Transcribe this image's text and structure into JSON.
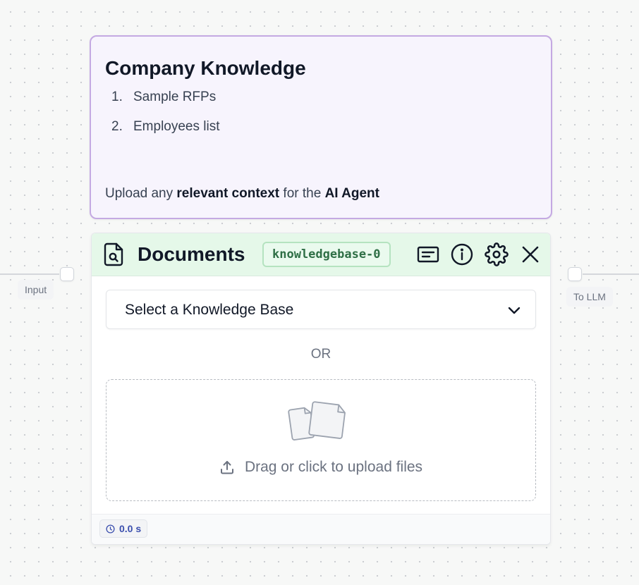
{
  "canvas": {
    "edges": [
      "input-edge",
      "output-edge"
    ]
  },
  "handles": {
    "input_label": "Input",
    "output_label": "To LLM"
  },
  "note": {
    "title": "Company Knowledge",
    "list": [
      {
        "number": "1.",
        "text": "Sample RFPs"
      },
      {
        "number": "2.",
        "text": "Employees list"
      }
    ],
    "footer_prefix": "Upload any ",
    "footer_bold_1": "relevant context",
    "footer_middle": " for the ",
    "footer_bold_2": "AI Agent",
    "colors": {
      "background": "#f7f4fd",
      "border": "#c4a9e2"
    }
  },
  "documents_node": {
    "title": "Documents",
    "badge": "knowledgebase-0",
    "header_icons": [
      "file-search-icon",
      "description-icon",
      "info-icon",
      "gear-icon",
      "close-icon"
    ],
    "select": {
      "placeholder": "Select a Knowledge Base",
      "icon": "chevron-down-icon"
    },
    "divider_text": "OR",
    "dropzone": {
      "text": "Drag or click to upload files",
      "icons": [
        "files-icon",
        "upload-icon"
      ]
    },
    "footer": {
      "timer": "0.0 s",
      "icon": "clock-icon"
    },
    "colors": {
      "header_bg": "#e5f8e9",
      "badge_border": "#b5e3c0",
      "badge_text": "#2f6f46",
      "timer_text": "#3b4fae"
    }
  }
}
